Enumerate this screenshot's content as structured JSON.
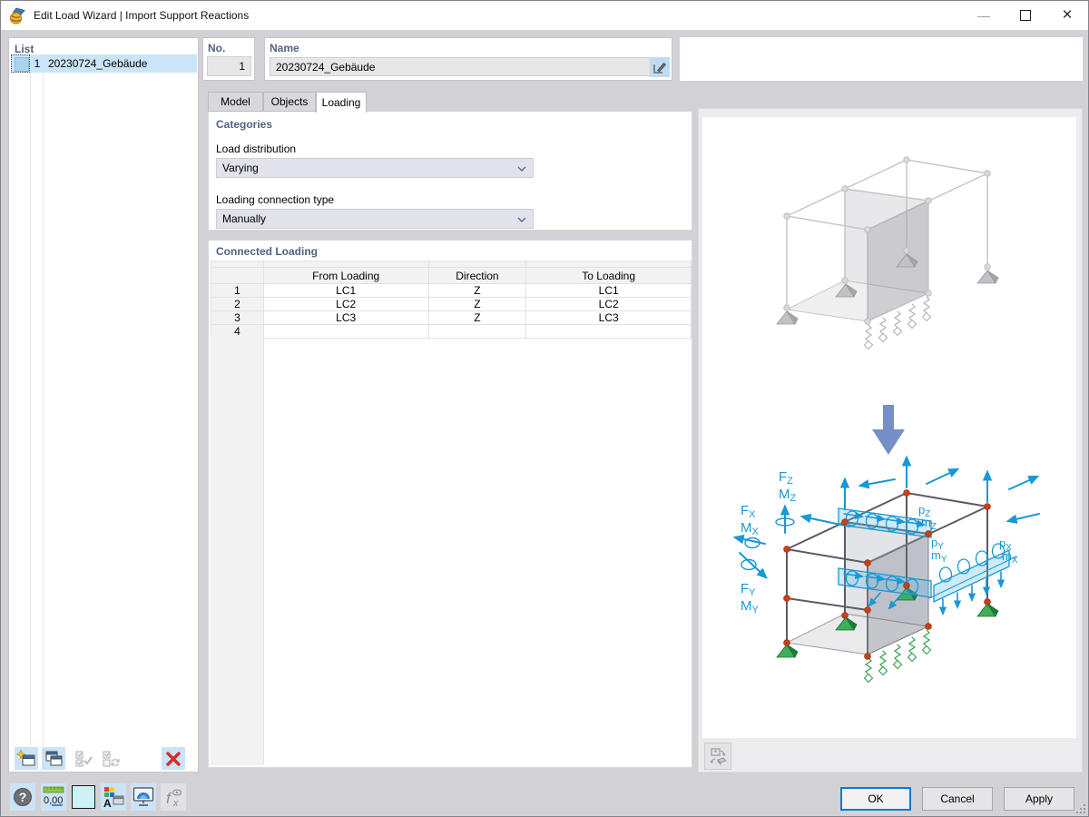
{
  "window": {
    "title": "Edit Load Wizard | Import Support Reactions",
    "minimize_glyph": "—",
    "close_glyph": "×"
  },
  "list_panel": {
    "header": "List",
    "items": [
      {
        "no": "1",
        "name": "20230724_Gebäude",
        "selected": true
      }
    ],
    "toolbar_icons": [
      "new-item",
      "copy-item",
      "check-all",
      "invert-checks",
      "delete-item"
    ]
  },
  "fields": {
    "no_label": "No.",
    "no_value": "1",
    "name_label": "Name",
    "name_value": "20230724_Gebäude"
  },
  "tabs": [
    {
      "label": "Model",
      "active": false
    },
    {
      "label": "Objects",
      "active": false
    },
    {
      "label": "Loading",
      "active": true
    }
  ],
  "categories": {
    "header": "Categories",
    "load_distribution_label": "Load distribution",
    "load_distribution_value": "Varying",
    "connection_type_label": "Loading connection type",
    "connection_type_value": "Manually"
  },
  "connected_loading": {
    "header": "Connected Loading",
    "columns": [
      "From Loading",
      "Direction",
      "To Loading"
    ],
    "rows": [
      [
        "1",
        "LC1",
        "Z",
        "LC1"
      ],
      [
        "2",
        "LC2",
        "Z",
        "LC2"
      ],
      [
        "3",
        "LC3",
        "Z",
        "LC3"
      ],
      [
        "4",
        "",
        "",
        ""
      ]
    ]
  },
  "diagram_labels": {
    "FZ": {
      "m": "F",
      "s": "Z"
    },
    "MZ": {
      "m": "M",
      "s": "Z"
    },
    "FX": {
      "m": "F",
      "s": "X"
    },
    "MX": {
      "m": "M",
      "s": "X"
    },
    "FY": {
      "m": "F",
      "s": "Y"
    },
    "MY": {
      "m": "M",
      "s": "Y"
    },
    "pz": {
      "m": "p",
      "s": "Z"
    },
    "mz": {
      "m": "m",
      "s": "Z"
    },
    "py": {
      "m": "p",
      "s": "Y"
    },
    "my": {
      "m": "m",
      "s": "Y"
    },
    "px": {
      "m": "p",
      "s": "X"
    },
    "mx": {
      "m": "m",
      "s": "X"
    }
  },
  "statusbar": {
    "units_text": "0,00",
    "icons": [
      "find-object",
      "units-decimal-places",
      "background-color",
      "display-properties",
      "rendering",
      "formula-disabled"
    ]
  },
  "footer": {
    "ok": "OK",
    "cancel": "Cancel",
    "apply": "Apply"
  },
  "colors": {
    "accent_blue": "#1898d5",
    "support_green": "#2fa04e",
    "node_red": "#c8401a",
    "header_blue": "#51627e",
    "selection_blue": "#cbe5f8",
    "big_arrow_blue": "#7590c8"
  }
}
